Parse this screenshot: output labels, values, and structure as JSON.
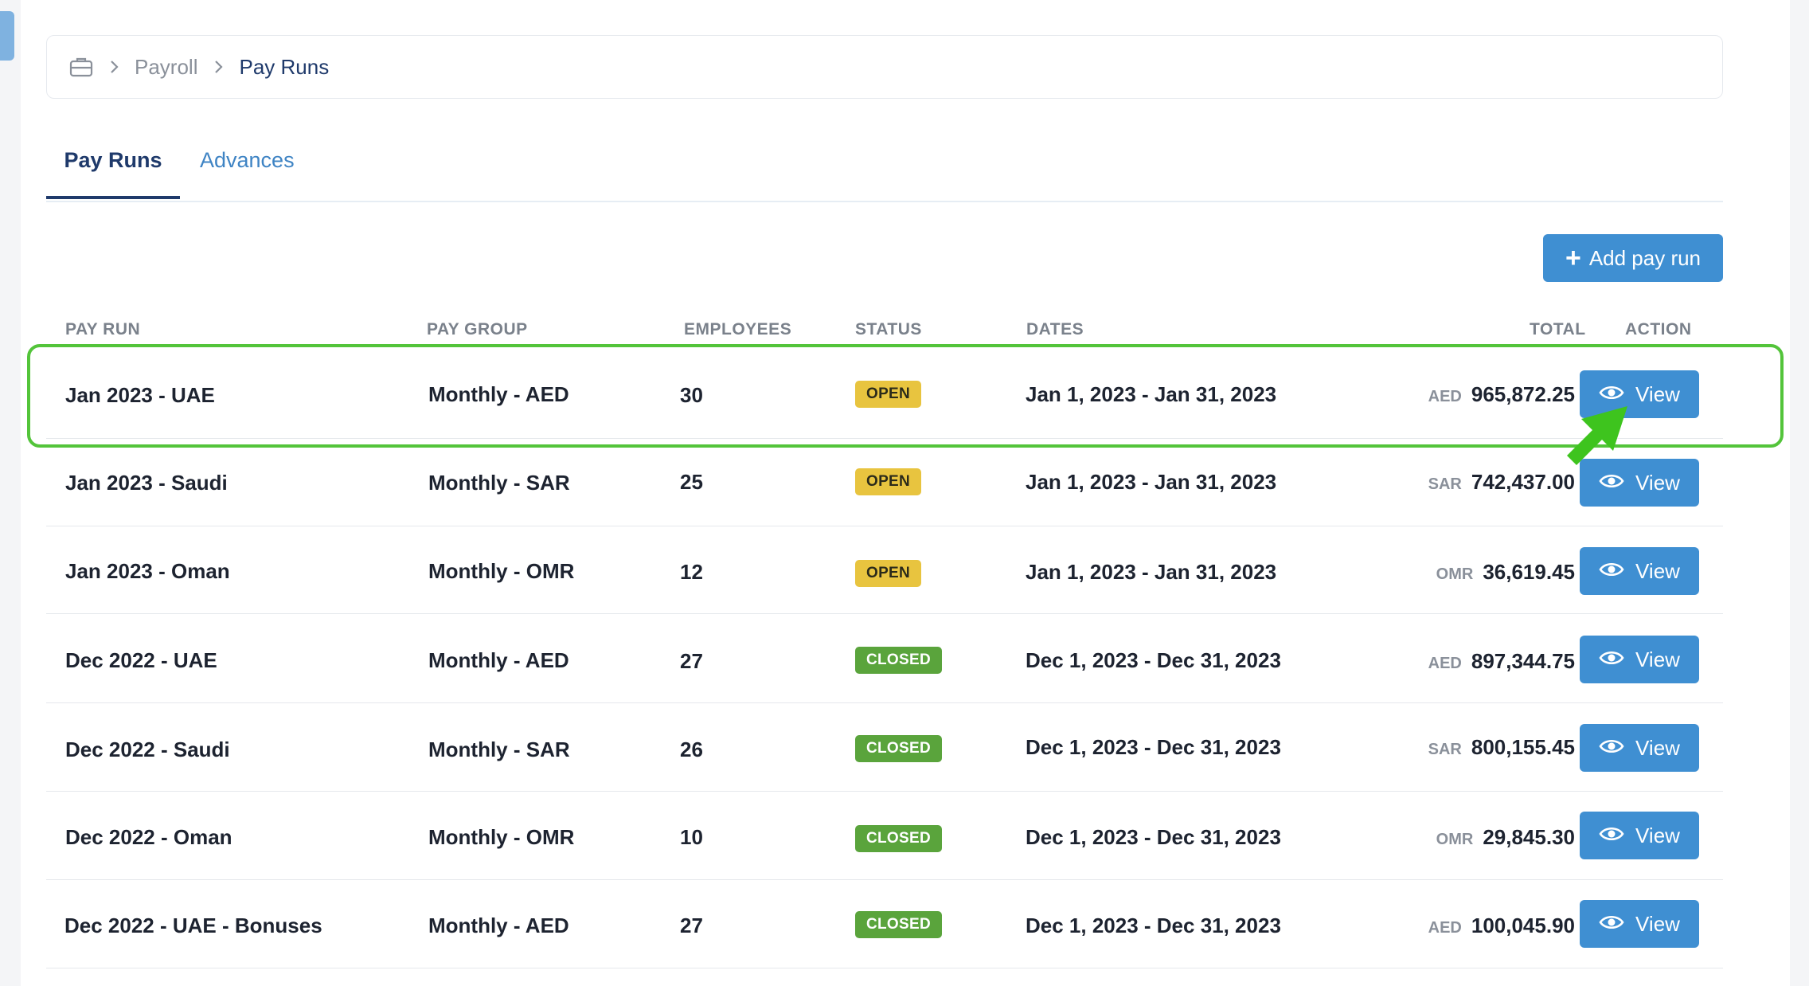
{
  "breadcrumb": {
    "items": [
      "Payroll",
      "Pay Runs"
    ]
  },
  "tabs": [
    {
      "label": "Pay Runs",
      "active": true
    },
    {
      "label": "Advances",
      "active": false
    }
  ],
  "add_button": {
    "label": "Add pay run"
  },
  "table": {
    "columns": [
      "PAY RUN",
      "PAY GROUP",
      "EMPLOYEES",
      "STATUS",
      "DATES",
      "TOTAL",
      "ACTION"
    ],
    "rows": [
      {
        "pay_run": "Jan 2023 - UAE",
        "pay_group": "Monthly - AED",
        "employees": "30",
        "status": "OPEN",
        "dates": "Jan 1, 2023 - Jan 31, 2023",
        "currency": "AED",
        "total": "965,872.25",
        "action": "View"
      },
      {
        "pay_run": "Jan 2023 - Saudi",
        "pay_group": "Monthly - SAR",
        "employees": "25",
        "status": "OPEN",
        "dates": "Jan 1, 2023 - Jan 31, 2023",
        "currency": "SAR",
        "total": "742,437.00",
        "action": "View"
      },
      {
        "pay_run": "Jan 2023 - Oman",
        "pay_group": "Monthly - OMR",
        "employees": "12",
        "status": "OPEN",
        "dates": "Jan 1, 2023 - Jan 31, 2023",
        "currency": "OMR",
        "total": "36,619.45",
        "action": "View"
      },
      {
        "pay_run": "Dec 2022 - UAE",
        "pay_group": "Monthly - AED",
        "employees": "27",
        "status": "CLOSED",
        "dates": "Dec 1, 2023 - Dec 31, 2023",
        "currency": "AED",
        "total": "897,344.75",
        "action": "View"
      },
      {
        "pay_run": "Dec 2022 - Saudi",
        "pay_group": "Monthly - SAR",
        "employees": "26",
        "status": "CLOSED",
        "dates": "Dec 1, 2023 - Dec 31, 2023",
        "currency": "SAR",
        "total": "800,155.45",
        "action": "View"
      },
      {
        "pay_run": "Dec 2022 - Oman",
        "pay_group": "Monthly - OMR",
        "employees": "10",
        "status": "CLOSED",
        "dates": "Dec 1, 2023 - Dec 31, 2023",
        "currency": "OMR",
        "total": "29,845.30",
        "action": "View"
      },
      {
        "pay_run": "Dec 2022 - UAE - Bonuses",
        "pay_group": "Monthly - AED",
        "employees": "27",
        "status": "CLOSED",
        "dates": "Dec 1, 2023 - Dec 31, 2023",
        "currency": "AED",
        "total": "100,045.90",
        "action": "View"
      }
    ]
  },
  "colors": {
    "primary": "#3f8fd2",
    "open": "#e8c43f",
    "closed": "#5aa43c",
    "highlight": "#53c43a",
    "nav": "#1f3a6b"
  },
  "icons": {
    "home": "briefcase-icon",
    "separator": "chevron-right-icon",
    "add": "plus-icon",
    "view": "eye-icon"
  }
}
